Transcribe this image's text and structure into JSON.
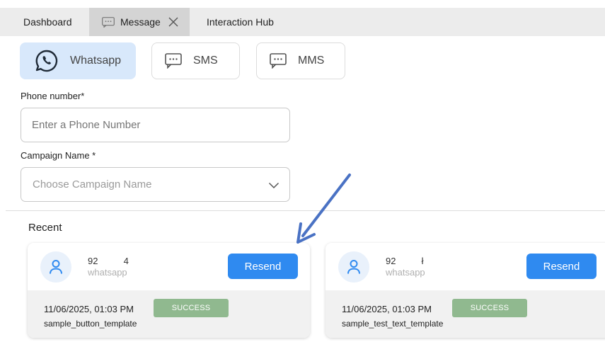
{
  "tabs": [
    {
      "label": "Dashboard"
    },
    {
      "label": "Message",
      "active": true,
      "icon": "chat-icon",
      "closable": true
    },
    {
      "label": "Interaction Hub"
    }
  ],
  "channels": [
    {
      "label": "Whatsapp",
      "icon": "whatsapp-icon",
      "selected": true
    },
    {
      "label": "SMS",
      "icon": "chat-icon",
      "selected": false
    },
    {
      "label": "MMS",
      "icon": "chat-icon",
      "selected": false
    }
  ],
  "form": {
    "phone_label": "Phone number*",
    "phone_placeholder": "Enter a Phone Number",
    "phone_value": "",
    "campaign_label": "Campaign Name *",
    "campaign_placeholder": "Choose Campaign Name"
  },
  "recent": {
    "title": "Recent",
    "items": [
      {
        "phone": "92          4",
        "channel": "whatsapp",
        "resend_label": "Resend",
        "datetime": "11/06/2025, 01:03 PM",
        "status": "SUCCESS",
        "template": "sample_button_template"
      },
      {
        "phone": "92          ł",
        "channel": "whatsapp",
        "resend_label": "Resend",
        "datetime": "11/06/2025, 01:03 PM",
        "status": "SUCCESS",
        "template": "sample_test_text_template"
      }
    ]
  },
  "colors": {
    "accent": "#2f8af0",
    "selected_channel_bg": "#d8e8fb",
    "success": "#90b98f",
    "annotation_arrow": "#4a72c4"
  }
}
